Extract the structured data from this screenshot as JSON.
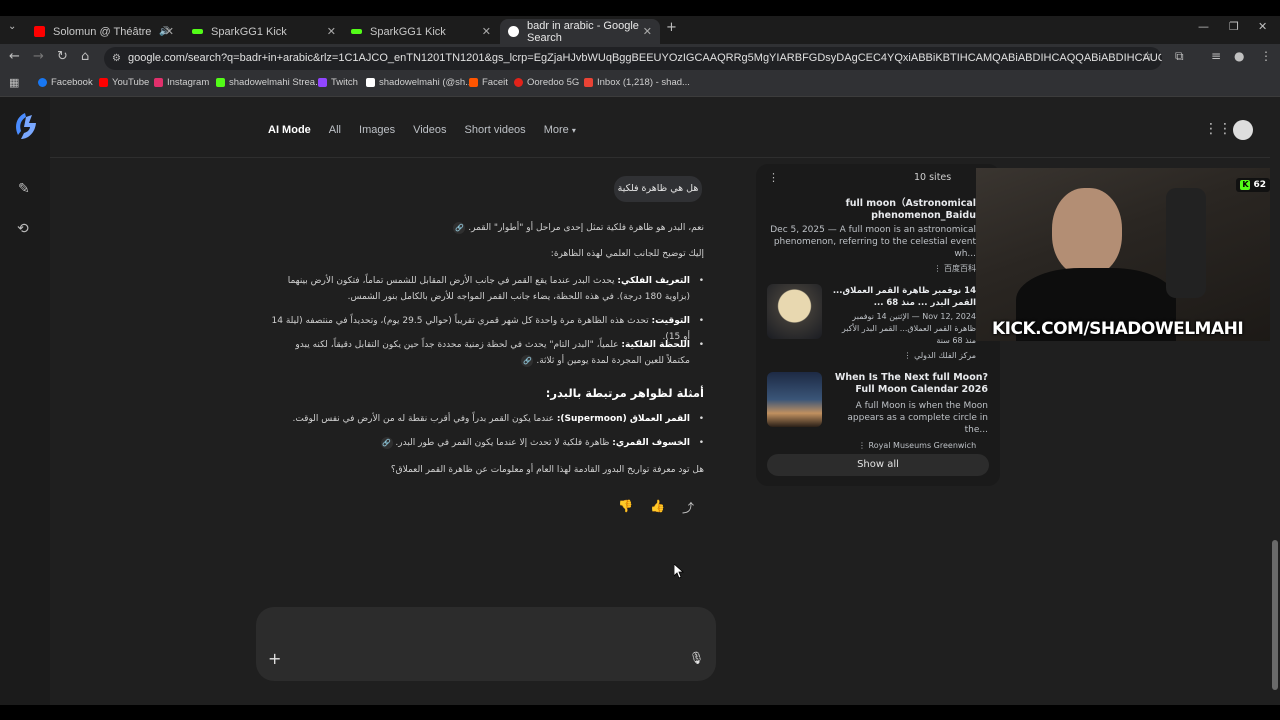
{
  "browser": {
    "tabs": [
      {
        "label": "Solomun @ Théâtre Antiqu",
        "icon": "youtube-icon",
        "color": "#ff0000"
      },
      {
        "label": "SparkGG1 Kick",
        "icon": "kick-icon",
        "color": "#53fc18"
      },
      {
        "label": "SparkGG1 Kick",
        "icon": "kick-icon",
        "color": "#53fc18"
      },
      {
        "label": "badr in arabic - Google Search",
        "icon": "google-icon",
        "color": "#4285f4"
      }
    ],
    "url": "google.com/search?q=badr+in+arabic&rlz=1C1AJCO_enTN1201TN1201&gs_lcrp=EgZjaHJvbWUqBggBEEUYOzIGCAAQRRg5MgYIARBFGDsyDAgCEC4YQxiABBiKBTIHCAMQABiABDIHCAQQABiABDIHCAUQLhiABDIHCAYQABiABDIHCAcQLhiABDI...",
    "bookmarks": [
      {
        "label": "Facebook",
        "color": "#1877f2"
      },
      {
        "label": "YouTube",
        "color": "#ff0000"
      },
      {
        "label": "Instagram",
        "color": "#e1306c"
      },
      {
        "label": "shadowelmahi Strea...",
        "color": "#53fc18"
      },
      {
        "label": "Twitch",
        "color": "#9146ff"
      },
      {
        "label": "shadowelmahi (@sh...",
        "color": "#ffffff"
      },
      {
        "label": "Faceit",
        "color": "#ff5500"
      },
      {
        "label": "Ooredoo 5G",
        "color": "#e2231a"
      },
      {
        "label": "Inbox (1,218) - shad...",
        "color": "#ea4335"
      }
    ]
  },
  "search_nav": {
    "items": [
      "AI Mode",
      "All",
      "Images",
      "Videos",
      "Short videos",
      "More"
    ]
  },
  "conversation": {
    "question": "هل هي ظاهرة فلكية",
    "intro": "نعم، البدر هو ظاهرة فلكية تمثل إحدى مراحل أو \"أطوار\" القمر.",
    "lead": "إليك توضيح للجانب العلمي لهذه الظاهرة:",
    "bullets": [
      {
        "label": "التعريف الفلكي:",
        "text": "يحدث البدر عندما يقع القمر في جانب الأرض المقابل للشمس تماماً، فتكون الأرض بينهما (بزاوية 180 درجة). في هذه اللحظة، يضاء جانب القمر المواجه للأرض بالكامل بنور الشمس."
      },
      {
        "label": "التوقيت:",
        "text": "تحدث هذه الظاهرة مرة واحدة كل شهر قمري تقريباً (حوالي 29.5 يوم)، وتحديداً في منتصفه (ليلة 14 أو 15)."
      },
      {
        "label": "اللحظة الفلكية:",
        "text": "علمياً، \"البدر التام\" يحدث في لحظة زمنية محددة جداً حين يكون التقابل دقيقاً، لكنه يبدو مكتملاً للعين المجردة لمدة يومين أو ثلاثة."
      }
    ],
    "examples_heading": "أمثلة لظواهر مرتبطة بالبدر:",
    "examples": [
      {
        "label": "القمر العملاق (Supermoon):",
        "text": "عندما يكون القمر بدراً وفي أقرب نقطة له من الأرض في نفس الوقت."
      },
      {
        "label": "الخسوف القمري:",
        "text": "ظاهرة فلكية لا تحدث إلا عندما يكون القمر في طور البدر."
      }
    ],
    "followup": "هل تود معرفة تواريخ البدور القادمة لهذا العام أو معلومات عن ظاهرة القمر العملاق؟"
  },
  "sources": {
    "count_label": "10 sites",
    "items": [
      {
        "title": "full moon（Astronomical phenomenon_Baidu",
        "date": "Dec 5, 2025 — A full moon is an astronomical phenomenon, referring to the celestial event wh...",
        "site": "百度百科"
      },
      {
        "title": "14 نوفمبر ظاهرة القمر العملاق... القمر البدر ... منذ 68 ...",
        "date": "Nov 12, 2024 — الإثنين 14 نوفمبر ظاهرة القمر العملاق... القمر البدر الأكبر منذ 68 سنة",
        "site": "مركز الفلك الدولي"
      },
      {
        "title": "When Is The Next full Moon? Full Moon Calendar 2026",
        "date": "A full Moon is when the Moon appears as a complete circle in the...",
        "site": "Royal Museums Greenwich"
      }
    ],
    "show_all": "Show all"
  },
  "stream": {
    "viewer_count": "62",
    "overlay": "KICK.COM/SHADOWELMAHI"
  }
}
